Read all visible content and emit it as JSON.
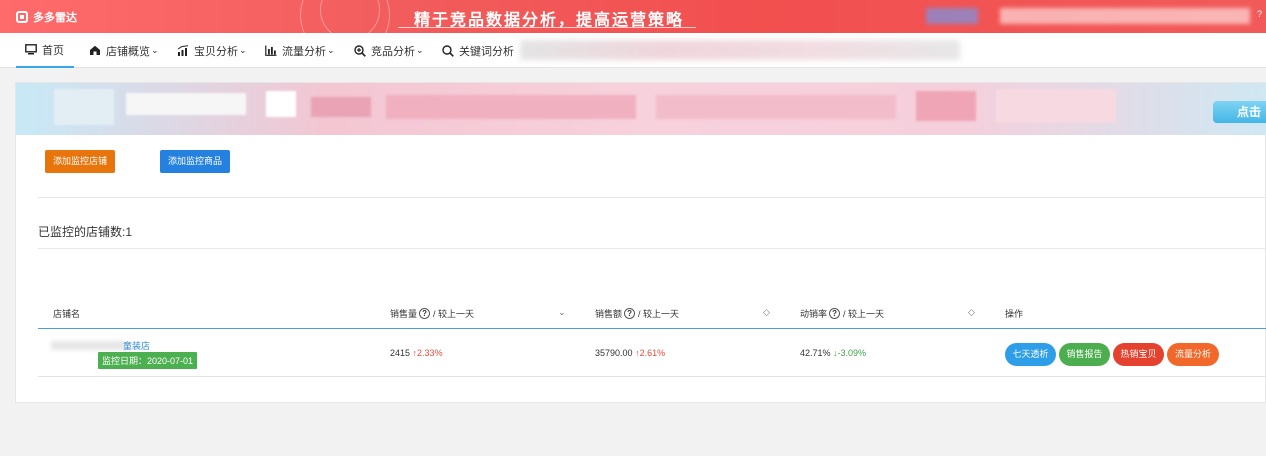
{
  "topbar": {
    "brand": "多多雷达",
    "slogan": "精于竞品数据分析，提高运营策略",
    "help_icon": "?"
  },
  "nav": {
    "items": [
      {
        "label": "首页",
        "icon": "monitor-icon"
      },
      {
        "label": "店铺概览",
        "icon": "shop-icon"
      },
      {
        "label": "宝贝分析",
        "icon": "chart-trend-icon"
      },
      {
        "label": "流量分析",
        "icon": "bar-chart-icon"
      },
      {
        "label": "竞品分析",
        "icon": "zoom-plus-icon"
      },
      {
        "label": "关键词分析",
        "icon": "search-icon"
      }
    ],
    "caret": "⌄"
  },
  "banner": {
    "cta": "点击"
  },
  "actions": {
    "add_store": "添加监控店铺",
    "add_product": "添加监控商品"
  },
  "summary": {
    "monitored_count_label": "已监控的店铺数:1"
  },
  "table": {
    "headers": {
      "store": "店铺名",
      "sales": "销售量",
      "amount": "销售额",
      "rate": "动销率",
      "compare": "/ 较上一天",
      "ops": "操作"
    },
    "sort_icons": {
      "sales": "⌄",
      "amount": "◇",
      "rate": "◇"
    },
    "rows": [
      {
        "store_name": "童装店",
        "monitor_date": "监控日期：2020-07-01",
        "sales": "2415",
        "sales_change": "↑2.33%",
        "amount": "35790.00",
        "amount_change": "↑2.61%",
        "rate": "42.71%",
        "rate_change": "↓-3.09%",
        "ops": [
          "七天透析",
          "销售报告",
          "热销宝贝",
          "流量分析"
        ]
      }
    ]
  },
  "colors": {
    "topbar": "#f25555",
    "add_store": "#e8740c",
    "add_product": "#2581e0",
    "op_blue": "#2f9ee8",
    "op_green": "#4cae4f",
    "op_red": "#e4412f",
    "op_orange": "#f2682a",
    "up": "#e84b3c",
    "down": "#3fa04b",
    "badge": "#4caf50"
  }
}
